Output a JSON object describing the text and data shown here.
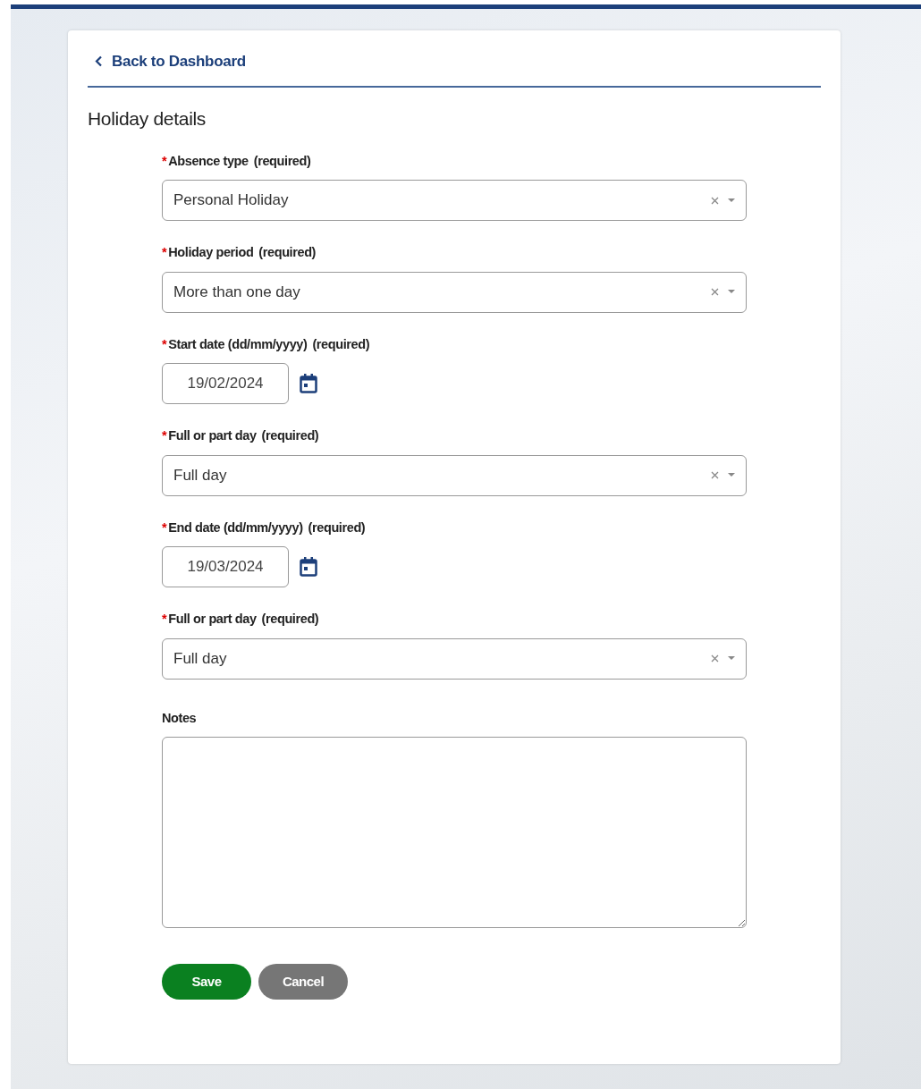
{
  "back_link": {
    "label": "Back to Dashboard"
  },
  "section_title": "Holiday details",
  "fields": [
    {
      "kind": "select",
      "marker": "*",
      "label": "Absence type",
      "hint": "(required)",
      "value": "Personal Holiday"
    },
    {
      "kind": "select",
      "marker": "*",
      "label": "Holiday period",
      "hint": "(required)",
      "value": "More than one day"
    },
    {
      "kind": "date",
      "marker": "*",
      "label": "Start date (dd/mm/yyyy)",
      "hint": "(required)",
      "value": "19/02/2024"
    },
    {
      "kind": "select",
      "marker": "*",
      "label": "Full or part day",
      "hint": "(required)",
      "value": "Full day"
    },
    {
      "kind": "date",
      "marker": "*",
      "label": "End date (dd/mm/yyyy)",
      "hint": "(required)",
      "value": "19/03/2024"
    },
    {
      "kind": "select",
      "marker": "*",
      "label": "Full or part day",
      "hint": "(required)",
      "value": "Full day"
    },
    {
      "kind": "textarea",
      "label": "Notes"
    }
  ],
  "buttons": [
    {
      "kind": "primary",
      "label": "Save"
    },
    {
      "kind": "secondary",
      "label": "Cancel"
    }
  ]
}
